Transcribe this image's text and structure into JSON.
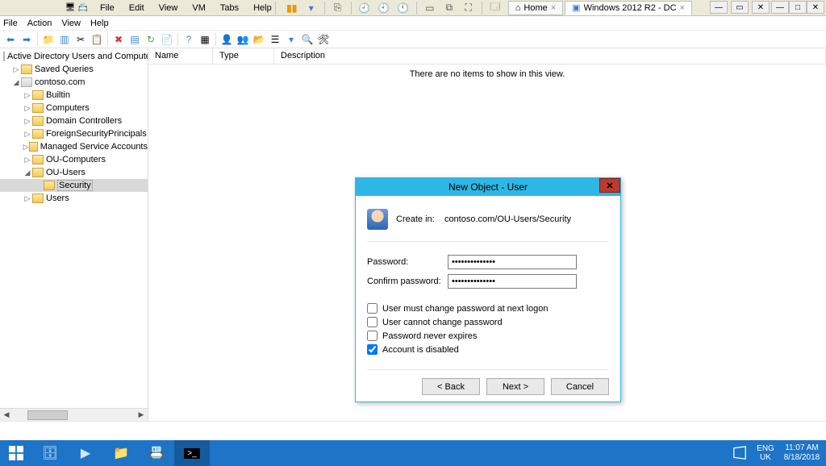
{
  "vm": {
    "menu": [
      "File",
      "Edit",
      "View",
      "VM",
      "Tabs",
      "Help"
    ],
    "tab_home": "Home",
    "tab_vm": "Windows 2012 R2 - DC"
  },
  "mmc": {
    "menu": [
      "File",
      "Action",
      "View",
      "Help"
    ]
  },
  "tree": {
    "root": "Active Directory Users and Computers [W",
    "saved_queries": "Saved Queries",
    "domain": "contoso.com",
    "children": [
      "Builtin",
      "Computers",
      "Domain Controllers",
      "ForeignSecurityPrincipals",
      "Managed Service Accounts",
      "OU-Computers"
    ],
    "ou_users": "OU-Users",
    "security": "Security",
    "users": "Users"
  },
  "list": {
    "cols": {
      "name": "Name",
      "type": "Type",
      "desc": "Description"
    },
    "empty": "There are no items to show in this view."
  },
  "dialog": {
    "title": "New Object - User",
    "create_in_label": "Create in:",
    "create_in_path": "contoso.com/OU-Users/Security",
    "password_label": "Password:",
    "confirm_label": "Confirm password:",
    "password_value": "••••••••••••••",
    "confirm_value": "••••••••••••••",
    "chk_mustchange": "User must change password at next logon",
    "chk_cannot": "User cannot change password",
    "chk_never": "Password never expires",
    "chk_disabled": "Account is disabled",
    "btn_back": "< Back",
    "btn_next": "Next >",
    "btn_cancel": "Cancel"
  },
  "taskbar": {
    "lang1": "ENG",
    "lang2": "UK",
    "time": "11:07 AM",
    "date": "8/18/2018"
  }
}
